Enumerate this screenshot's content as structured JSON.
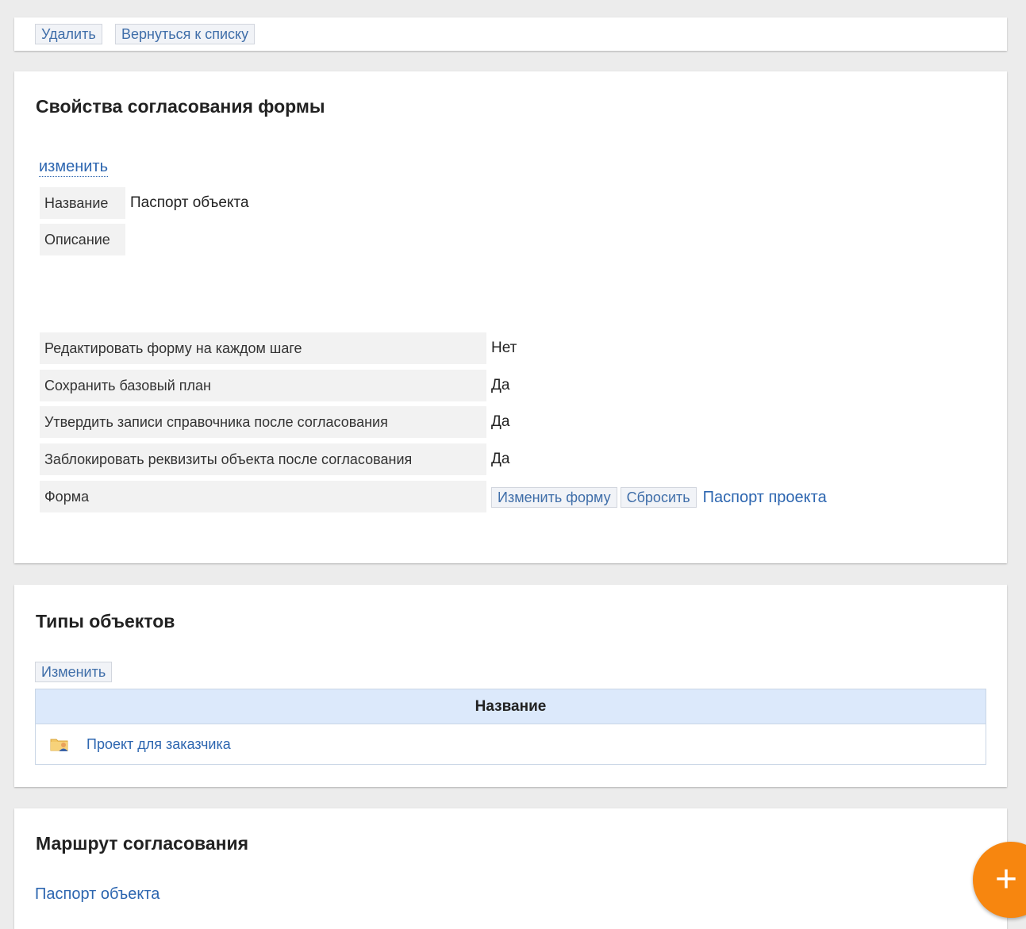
{
  "toolbar": {
    "delete_label": "Удалить",
    "back_label": "Вернуться к списку"
  },
  "properties": {
    "title": "Свойства согласования формы",
    "edit_link": "изменить",
    "name_label": "Название",
    "name_value": "Паспорт объекта",
    "description_label": "Описание",
    "description_value": "",
    "rows": [
      {
        "label": "Редактировать форму на каждом шаге",
        "value": "Нет"
      },
      {
        "label": "Сохранить базовый план",
        "value": "Да"
      },
      {
        "label": "Утвердить записи справочника после согласования",
        "value": "Да"
      },
      {
        "label": "Заблокировать реквизиты объекта после согласования",
        "value": "Да"
      }
    ],
    "form_label": "Форма",
    "change_form_button": "Изменить форму",
    "reset_button": "Сбросить",
    "form_link": "Паспорт проекта"
  },
  "object_types": {
    "title": "Типы объектов",
    "change_button": "Изменить",
    "column_header": "Название",
    "rows": [
      {
        "icon": "folder-user-icon",
        "name": "Проект для заказчика"
      }
    ]
  },
  "route": {
    "title": "Маршрут согласования",
    "link": "Паспорт объекта"
  },
  "fab": {
    "icon": "plus-icon",
    "symbol": "+"
  },
  "colors": {
    "accent": "#f7860f",
    "link": "#2d66b0",
    "grid_header": "#dce9fb"
  }
}
